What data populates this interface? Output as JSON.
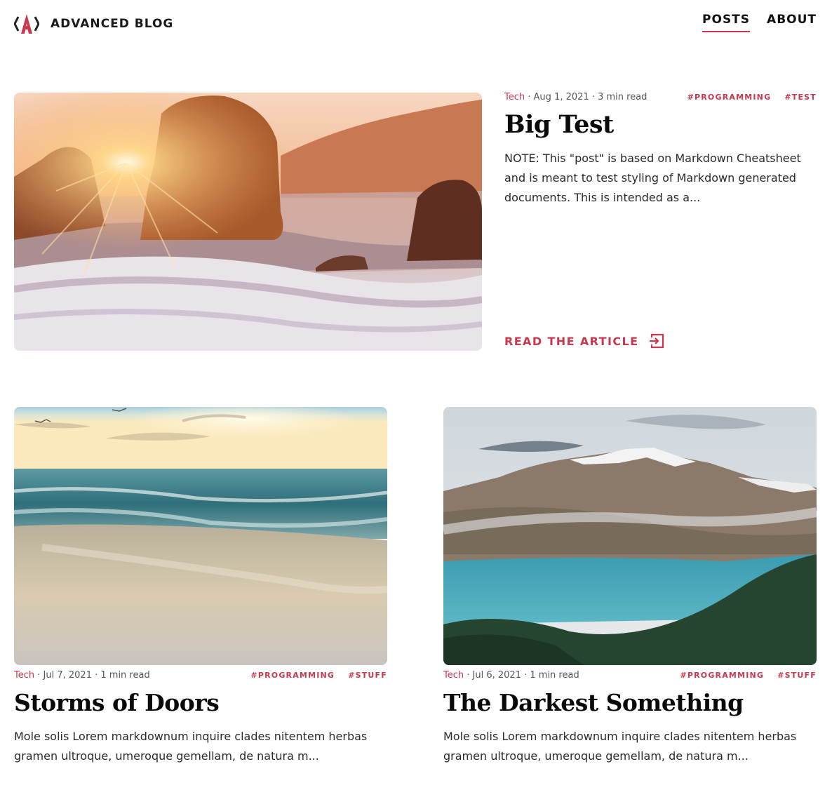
{
  "header": {
    "brand_name": "ADVANCED BLOG",
    "nav": [
      {
        "label": "POSTS",
        "active": true
      },
      {
        "label": "ABOUT",
        "active": false
      }
    ]
  },
  "featured_post": {
    "category": "Tech",
    "date": "Aug 1, 2021",
    "read_time": "3 min read",
    "tags": [
      "#PROGRAMMING",
      "#TEST"
    ],
    "title": "Big Test",
    "excerpt": "NOTE: This \"post\" is based on Markdown Cheatsheet and is meant to test styling of Markdown generated documents. This is intended as a...",
    "cta_label": "READ THE ARTICLE",
    "image": "sunset-beach-rocks"
  },
  "posts": [
    {
      "category": "Tech",
      "date": "Jul 7, 2021",
      "read_time": "1 min read",
      "tags": [
        "#PROGRAMMING",
        "#STUFF"
      ],
      "title": "Storms of Doors",
      "excerpt": "Mole solis Lorem markdownum inquire clades nitentem herbas gramen ultroque, umeroque gemellam, de natura m...",
      "image": "ocean-waves-sunrise"
    },
    {
      "category": "Tech",
      "date": "Jul 6, 2021",
      "read_time": "1 min read",
      "tags": [
        "#PROGRAMMING",
        "#STUFF"
      ],
      "title": "The Darkest Something",
      "excerpt": "Mole solis Lorem markdownum inquire clades nitentem herbas gramen ultroque, umeroque gemellam, de natura m...",
      "image": "mountain-lake"
    }
  ],
  "colors": {
    "accent": "#c9384e",
    "text": "#111111"
  }
}
